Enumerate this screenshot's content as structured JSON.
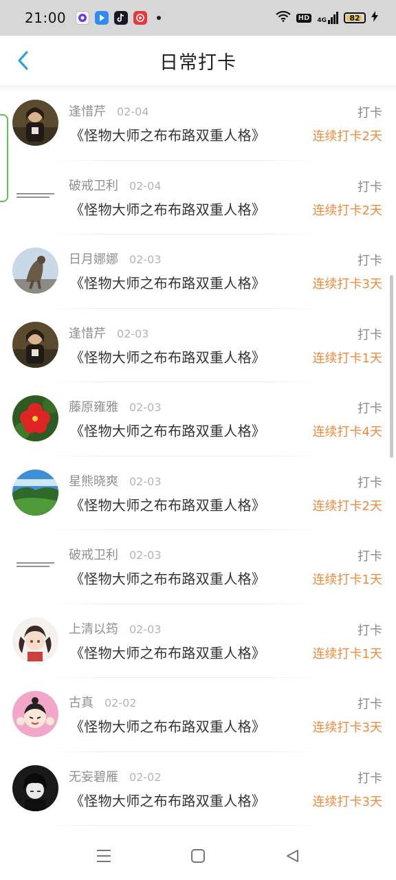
{
  "status_bar": {
    "time": "21:00",
    "app_icons": [
      "browser-icon",
      "play-store-icon",
      "tiktok-icon",
      "cloud-music-icon"
    ],
    "hd_label": "HD",
    "network_label": "4G",
    "battery_level": "82"
  },
  "header": {
    "title": "日常打卡"
  },
  "checkins": [
    {
      "username": "逢惜芹",
      "date": "02-04",
      "book": "《怪物大师之布布路双重人格》",
      "action": "打卡",
      "streak": "连续打卡2天",
      "avatar": "avatar-photo-girl"
    },
    {
      "username": "破戒卫利",
      "date": "02-04",
      "book": "《怪物大师之布布路双重人格》",
      "action": "打卡",
      "streak": "连续打卡2天",
      "avatar": "avatar-text-note"
    },
    {
      "username": "日月娜娜",
      "date": "02-03",
      "book": "《怪物大师之布布路双重人格》",
      "action": "打卡",
      "streak": "连续打卡3天",
      "avatar": "avatar-cat"
    },
    {
      "username": "逢惜芹",
      "date": "02-03",
      "book": "《怪物大师之布布路双重人格》",
      "action": "打卡",
      "streak": "连续打卡1天",
      "avatar": "avatar-photo-girl"
    },
    {
      "username": "藤原雍雅",
      "date": "02-03",
      "book": "《怪物大师之布布路双重人格》",
      "action": "打卡",
      "streak": "连续打卡4天",
      "avatar": "avatar-red-flower"
    },
    {
      "username": "星熊晓爽",
      "date": "02-03",
      "book": "《怪物大师之布布路双重人格》",
      "action": "打卡",
      "streak": "连续打卡2天",
      "avatar": "avatar-landscape"
    },
    {
      "username": "破戒卫利",
      "date": "02-03",
      "book": "《怪物大师之布布路双重人格》",
      "action": "打卡",
      "streak": "连续打卡1天",
      "avatar": "avatar-text-note"
    },
    {
      "username": "上清以筠",
      "date": "02-03",
      "book": "《怪物大师之布布路双重人格》",
      "action": "打卡",
      "streak": "连续打卡1天",
      "avatar": "avatar-anime-girl"
    },
    {
      "username": "古真",
      "date": "02-02",
      "book": "《怪物大师之布布路双重人格》",
      "action": "打卡",
      "streak": "连续打卡3天",
      "avatar": "avatar-pink-cartoon"
    },
    {
      "username": "无妄碧雁",
      "date": "02-02",
      "book": "《怪物大师之布布路双重人格》",
      "action": "打卡",
      "streak": "连续打卡3天",
      "avatar": "avatar-dark-anime"
    }
  ],
  "nav_bar": {
    "buttons": [
      "menu-icon",
      "home-icon",
      "back-triangle-icon"
    ]
  },
  "colors": {
    "accent_blue": "#2aa3e6",
    "streak_orange": "#f08a3c",
    "status_bar_bg": "#d7d7d7",
    "side_tab_green": "#5cc05c"
  }
}
